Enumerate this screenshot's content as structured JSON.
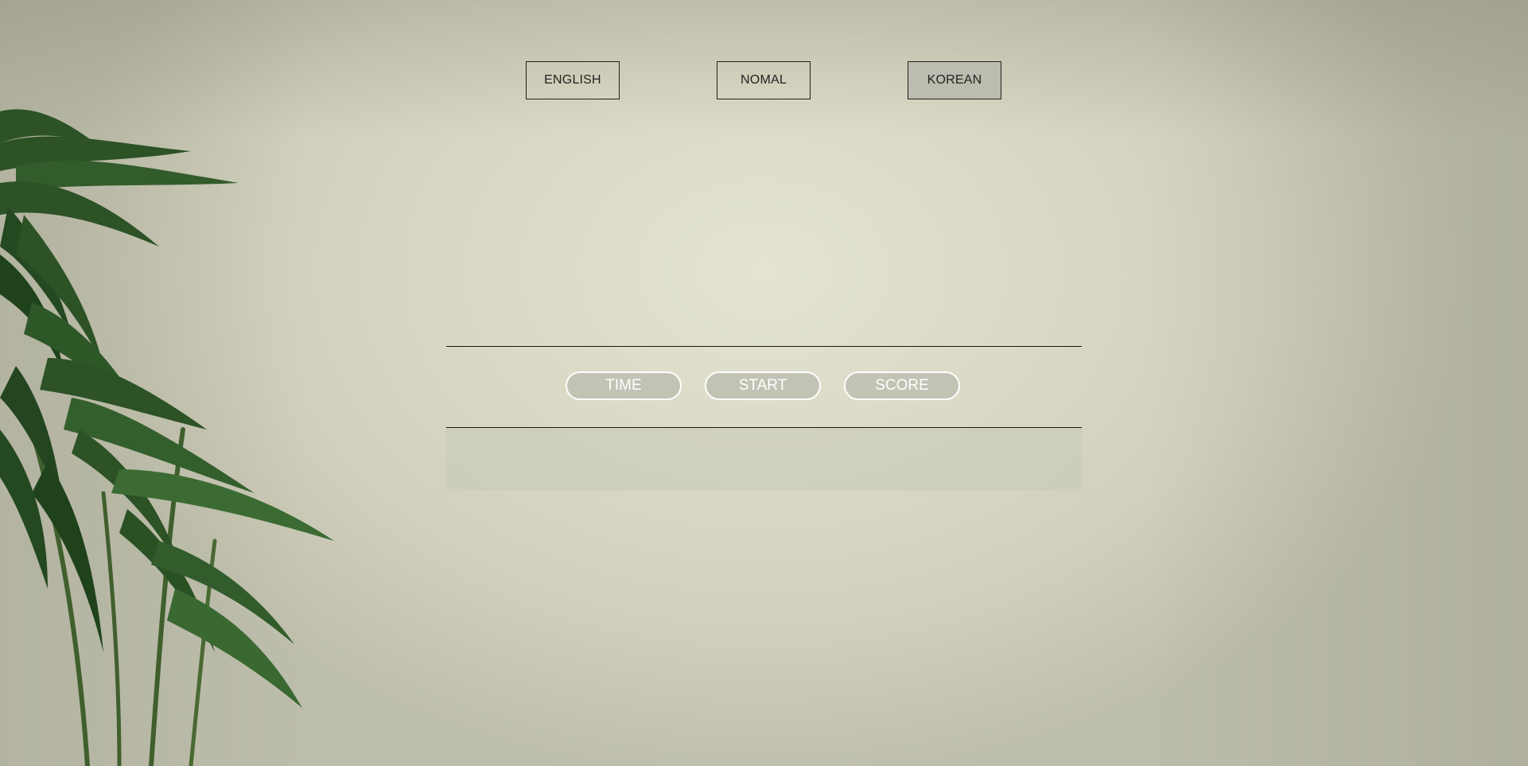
{
  "modes": {
    "english_label": "ENGLISH",
    "normal_label": "NOMAL",
    "korean_label": "KOREAN",
    "selected": "KOREAN"
  },
  "controls": {
    "time_label": "TIME",
    "start_label": "START",
    "score_label": "SCORE"
  },
  "word_display": {
    "text": ""
  },
  "typing_input": {
    "value": "",
    "placeholder": ""
  },
  "icons": {
    "background": "palm-plant-image"
  },
  "colors": {
    "wall": "#d9d9c5",
    "plant": "#2f5a2c",
    "pill_border": "#ffffff",
    "selected_mode": "#bcbcaf"
  }
}
